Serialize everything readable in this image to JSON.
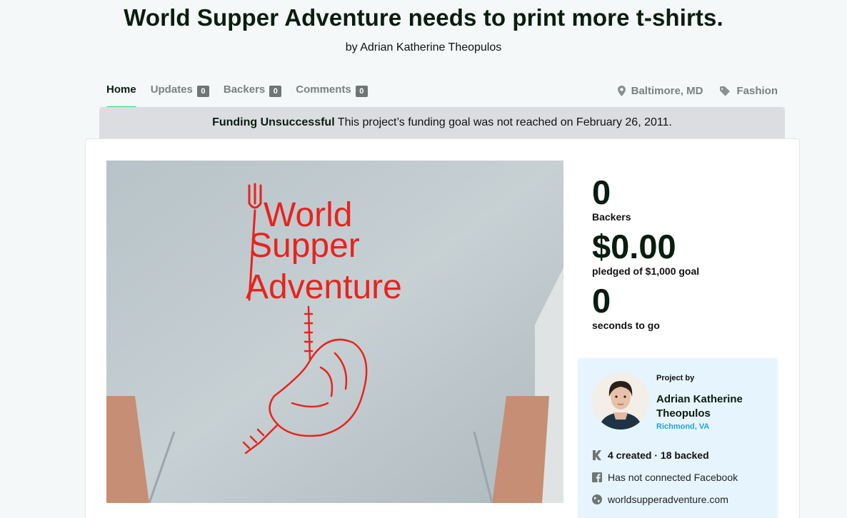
{
  "project": {
    "title": "World Supper Adventure needs to print more t-shirts.",
    "byline": "by Adrian Katherine Theopulos"
  },
  "tabs": [
    {
      "label": "Home",
      "count": null
    },
    {
      "label": "Updates",
      "count": "0"
    },
    {
      "label": "Backers",
      "count": "0"
    },
    {
      "label": "Comments",
      "count": "0"
    }
  ],
  "meta": {
    "location": "Baltimore, MD",
    "category": "Fashion"
  },
  "banner": {
    "status": "Funding Unsuccessful",
    "message": " This project’s funding goal was not reached on February 26, 2011."
  },
  "hero": {
    "shirt_text": [
      "World",
      "Supper",
      "Adventure"
    ]
  },
  "stats": {
    "backers_value": "0",
    "backers_label": "Backers",
    "pledged_value": "$0.00",
    "pledged_label": "pledged of $1,000 goal",
    "time_value": "0",
    "time_label": "seconds to go"
  },
  "creator": {
    "project_by": "Project by",
    "name": "Adrian Katherine Theopulos",
    "location": "Richmond, VA",
    "created_backed": "4 created · 18 backed",
    "facebook": "Has not connected Facebook",
    "website": "worldsupperadventure.com"
  },
  "colors": {
    "accent_green": "#2bde73",
    "banner_bg": "#dcdde1",
    "creator_bg": "#e6f4fd",
    "link_blue": "#1da6d8",
    "shirt_print_red": "#e8231e"
  }
}
